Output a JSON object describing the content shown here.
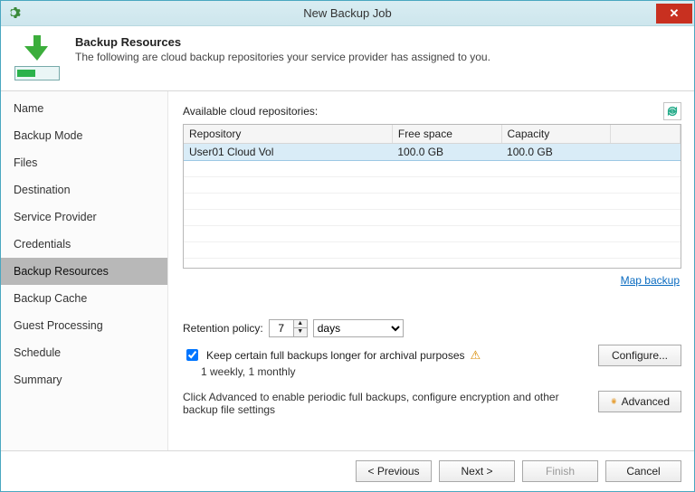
{
  "window": {
    "title": "New Backup Job"
  },
  "header": {
    "title": "Backup Resources",
    "subtitle": "The following are cloud backup repositories your service provider has assigned to you."
  },
  "sidebar": {
    "items": [
      {
        "label": "Name"
      },
      {
        "label": "Backup Mode"
      },
      {
        "label": "Files"
      },
      {
        "label": "Destination"
      },
      {
        "label": "Service Provider"
      },
      {
        "label": "Credentials"
      },
      {
        "label": "Backup Resources"
      },
      {
        "label": "Backup Cache"
      },
      {
        "label": "Guest Processing"
      },
      {
        "label": "Schedule"
      },
      {
        "label": "Summary"
      }
    ],
    "active_index": 6
  },
  "main": {
    "repos_label": "Available cloud repositories:",
    "columns": {
      "repo": "Repository",
      "free": "Free space",
      "cap": "Capacity"
    },
    "rows": [
      {
        "repo": "User01 Cloud Vol",
        "free": "100.0 GB",
        "cap": "100.0 GB"
      }
    ],
    "map_link": "Map backup",
    "retention_label": "Retention policy:",
    "retention_value": "7",
    "retention_unit": "days",
    "keep_label": "Keep certain full backups longer for archival purposes",
    "keep_summary": "1 weekly, 1 monthly",
    "configure_label": "Configure...",
    "advanced_hint": "Click Advanced to enable periodic full backups, configure encryption and other backup file settings",
    "advanced_label": "Advanced"
  },
  "footer": {
    "previous": "< Previous",
    "next": "Next >",
    "finish": "Finish",
    "cancel": "Cancel"
  }
}
